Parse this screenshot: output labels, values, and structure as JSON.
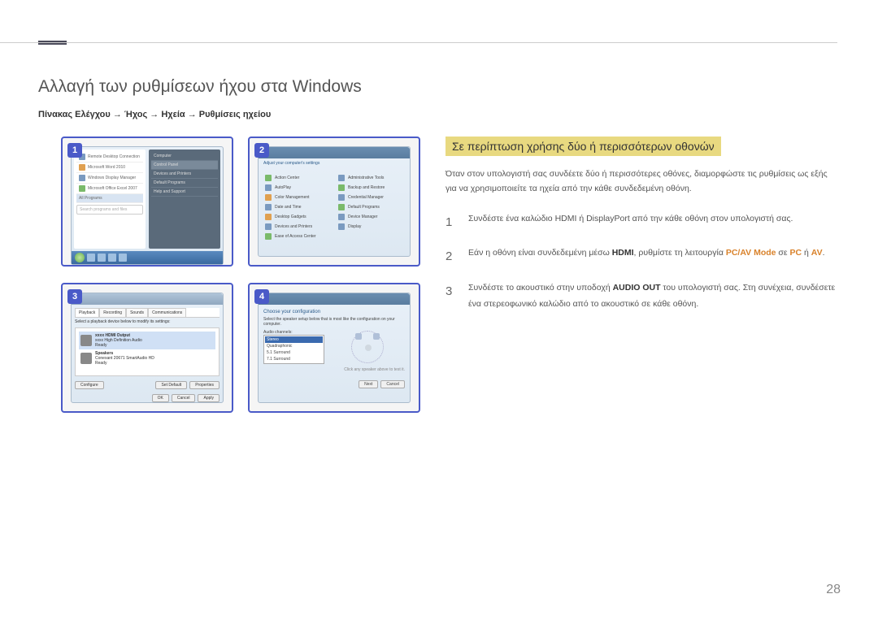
{
  "page": {
    "title": "Αλλαγή των ρυθμίσεων ήχου στα Windows",
    "breadcrumb": "Πίνακας Ελέγχου → Ήχος → Ηχεία → Ρυθμίσεις ηχείου",
    "page_number": "28"
  },
  "thumbs": [
    {
      "num": "1"
    },
    {
      "num": "2"
    },
    {
      "num": "3"
    },
    {
      "num": "4"
    }
  ],
  "startmenu": {
    "items": [
      "Remote Desktop Connection",
      "Microsoft Word 2010",
      "Windows Display Manager",
      "Microsoft Office Excel 2007"
    ],
    "all_programs": "All Programs",
    "right_items": [
      "Computer",
      "Control Panel",
      "Devices and Printers",
      "Default Programs",
      "Help and Support"
    ],
    "search_placeholder": "Search programs and files"
  },
  "controlpanel": {
    "header": "Adjust your computer's settings",
    "items": [
      "Action Center",
      "Administrative Tools",
      "AutoPlay",
      "Backup and Restore",
      "Color Management",
      "Credential Manager",
      "Date and Time",
      "Default Programs",
      "Desktop Gadgets",
      "Device Manager",
      "Devices and Printers",
      "Display",
      "Ease of Access Center"
    ]
  },
  "sound": {
    "tabs": [
      "Playback",
      "Recording",
      "Sounds",
      "Communications"
    ],
    "hint": "Select a playback device below to modify its settings:",
    "devices": [
      {
        "name": "xxxx HDMI Output",
        "sub": "xxxx High Definition Audio",
        "status": "Ready"
      },
      {
        "name": "Speakers",
        "sub": "Conexant 20671 SmartAudio HD",
        "status": "Ready"
      }
    ],
    "buttons": [
      "Configure",
      "Set Default",
      "Properties",
      "OK",
      "Cancel",
      "Apply"
    ]
  },
  "speaker_setup": {
    "title": "Choose your configuration",
    "hint": "Select the speaker setup below that is most like the configuration on your computer.",
    "label": "Audio channels:",
    "options": [
      "Stereo",
      "Quadraphonic",
      "5.1 Surround",
      "7.1 Surround"
    ],
    "test_hint": "Click any speaker above to test it.",
    "buttons": [
      "Next",
      "Cancel"
    ]
  },
  "right": {
    "subtitle": "Σε περίπτωση χρήσης δύο ή περισσότερων οθονών",
    "intro": "Όταν στον υπολογιστή σας συνδέετε δύο ή περισσότερες οθόνες, διαμορφώστε τις ρυθμίσεις ως εξής για να χρησιμοποιείτε τα ηχεία από την κάθε συνδεδεμένη οθόνη.",
    "steps": [
      {
        "num": "1",
        "text": "Συνδέστε ένα καλώδιο HDMI ή DisplayPort από την κάθε οθόνη στον υπολογιστή σας."
      },
      {
        "num": "2",
        "prefix": "Εάν η οθόνη είναι συνδεδεμένη μέσω ",
        "hdmi": "HDMI",
        "mid": ", ρυθμίστε τη λειτουργία ",
        "pcav": "PC/AV Mode",
        "mid2": " σε ",
        "pc": "PC",
        "or": " ή ",
        "av": "AV",
        "end": "."
      },
      {
        "num": "3",
        "prefix": "Συνδέστε το ακουστικό στην υποδοχή ",
        "audioout": "AUDIO OUT",
        "suffix": " του υπολογιστή σας. Στη συνέχεια, συνδέσετε ένα στερεοφωνικό καλώδιο από το ακουστικό σε κάθε οθόνη."
      }
    ]
  }
}
